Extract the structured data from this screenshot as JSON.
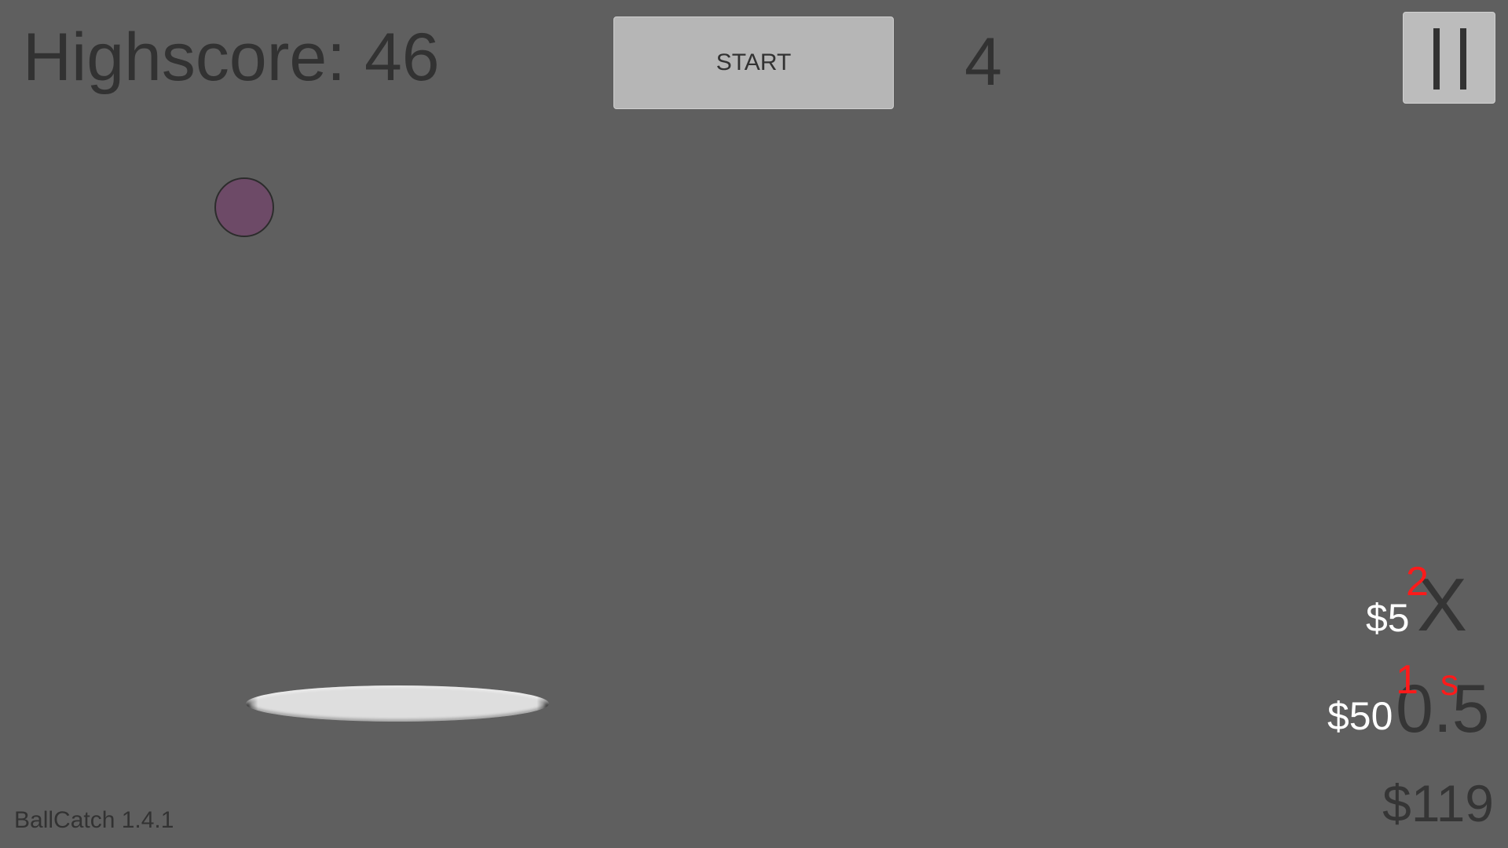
{
  "hud": {
    "highscore": "Highscore: 46",
    "score": "4",
    "start_label": "START",
    "wallet": "$119",
    "version": "BallCatch 1.4.1"
  },
  "icons": {
    "pause": "pause-icon"
  },
  "shop": {
    "multiplier": {
      "price": "$5",
      "symbol": "X",
      "count": "2"
    },
    "slowmo": {
      "price": "$50",
      "symbol": "0.5",
      "count": "1",
      "unit": "s"
    }
  },
  "colors": {
    "background": "#5f5f5f",
    "ball": "#6d4a67",
    "paddle": "#dedede",
    "button": "#b6b6b6",
    "text_dark": "#323232",
    "price": "#ffffff",
    "count": "#ff1a1a"
  }
}
